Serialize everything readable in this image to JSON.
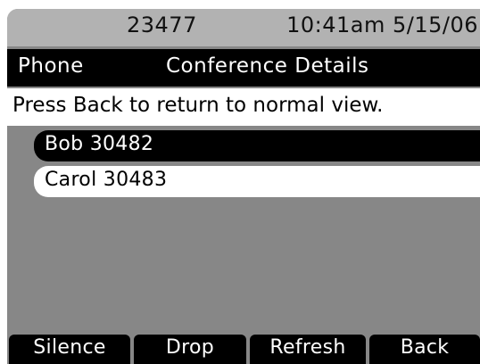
{
  "status_bar": {
    "extension": "23477",
    "datetime": "10:41am 5/15/06"
  },
  "title_bar": {
    "app": "Phone",
    "screen": "Conference Details"
  },
  "prompt": "Press Back to return to normal view.",
  "participants": [
    {
      "label": "Bob 30482",
      "selected": true
    },
    {
      "label": "Carol 30483",
      "selected": false
    }
  ],
  "softkeys": [
    {
      "label": "Silence"
    },
    {
      "label": "Drop"
    },
    {
      "label": "Refresh"
    },
    {
      "label": "Back"
    }
  ],
  "colors": {
    "display_background": "#878787",
    "status_bar": "#b2b2b2",
    "highlight": "#000000",
    "text_on_highlight": "#ffffff"
  }
}
